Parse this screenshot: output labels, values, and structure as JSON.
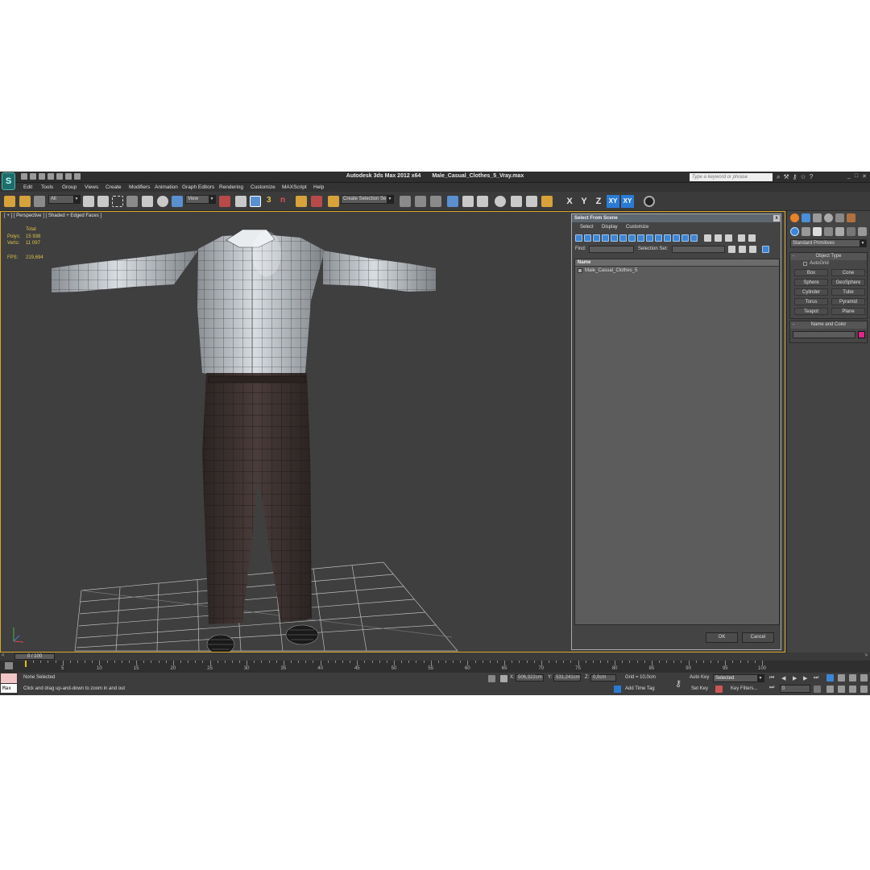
{
  "titlebar": {
    "app_name": "Autodesk 3ds Max  2012 x64",
    "file_name": "Male_Casual_Clothes_5_Vray.max",
    "search_placeholder": "Type a keyword or phrase",
    "logo": "S"
  },
  "menu": [
    "Edit",
    "Tools",
    "Group",
    "Views",
    "Create",
    "Modifiers",
    "Animation",
    "Graph Editors",
    "Rendering",
    "Customize",
    "MAXScript",
    "Help"
  ],
  "toolbar": {
    "selection_filter": "All",
    "ref_coord": "View",
    "named_selection": "Create Selection Se",
    "axes": [
      "X",
      "Y",
      "Z",
      "XY",
      "XY"
    ],
    "snap_label": "3",
    "angle_snap": "n"
  },
  "viewport": {
    "label": "[ + ] [ Perspective ] [ Shaded + Edged Faces ]",
    "stats": {
      "total_label": "Total",
      "polys_label": "Polys:",
      "polys_value": "15 938",
      "verts_label": "Verts:",
      "verts_value": "11 097",
      "fps_label": "FPS:",
      "fps_value": "219,694"
    }
  },
  "dialog": {
    "title": "Select From Scene",
    "close": "x",
    "menu": [
      "Select",
      "Display",
      "Customize"
    ],
    "find_label": "Find:",
    "selection_set_label": "Selection Set:",
    "column_header": "Name",
    "items": [
      "Male_Casual_Clothes_5"
    ],
    "ok": "OK",
    "cancel": "Cancel"
  },
  "command_panel": {
    "dropdown": "Standard Primitives",
    "object_type_title": "Object Type",
    "autogrid": "AutoGrid",
    "primitives": [
      "Box",
      "Cone",
      "Sphere",
      "GeoSphere",
      "Cylinder",
      "Tube",
      "Torus",
      "Pyramid",
      "Teapot",
      "Plane"
    ],
    "name_color_title": "Name and Color",
    "rollout_toggle": "-",
    "color": "#e0258a"
  },
  "timeline": {
    "slider": "0 / 100",
    "left_arrow": "<",
    "right_arrow": ">",
    "ticks": [
      "5",
      "10",
      "15",
      "20",
      "25",
      "30",
      "35",
      "40",
      "45",
      "50",
      "55",
      "60",
      "65",
      "70",
      "75",
      "80",
      "85",
      "90",
      "95",
      "100"
    ]
  },
  "status": {
    "selection": "None Selected",
    "hint": "Click and drag up-and-down to zoom in and out",
    "maxscript_label": "Max",
    "x_label": "X:",
    "x_value": "506,322cm",
    "y_label": "Y:",
    "y_value": "531,241cm",
    "z_label": "Z:",
    "z_value": "0,0cm",
    "grid": "Grid = 10,0cm",
    "add_time_tag": "Add Time Tag",
    "auto_key": "Auto Key",
    "set_key": "Set Key",
    "selected": "Selected",
    "key_filters": "Key Filters...",
    "frame": "0"
  }
}
